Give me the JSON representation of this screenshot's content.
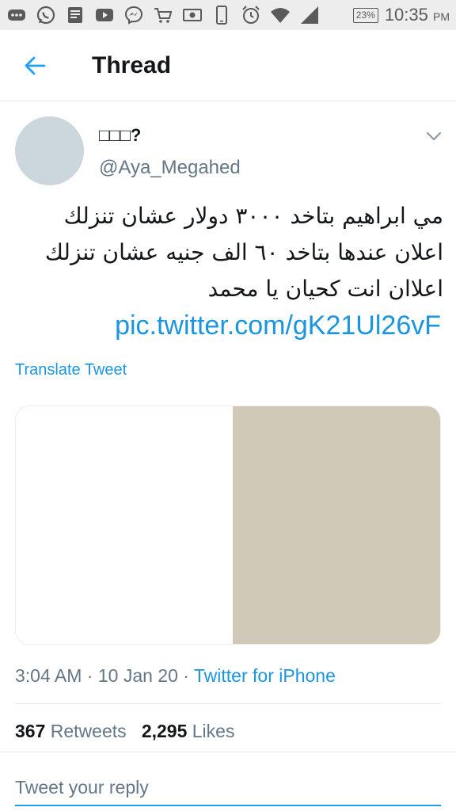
{
  "status_bar": {
    "icons": [
      "more-icon",
      "whatsapp-icon",
      "news-icon",
      "youtube-icon",
      "messenger-icon",
      "cart-icon",
      "cash-icon",
      "phone-icon",
      "alarm-icon",
      "wifi-icon",
      "signal-icon"
    ],
    "battery": "23%",
    "time": "10:35",
    "ampm": "PM"
  },
  "app_bar": {
    "title": "Thread"
  },
  "tweet": {
    "display_name": "□□□?",
    "handle": "@Aya_Megahed",
    "text": "مي ابراهيم بتاخد ٣٠٠٠ دولار عشان تنزلك اعلان عندها بتاخد ٦٠ الف جنيه عشان تنزلك اعلاان انت كحيان يا محمد",
    "link": "pic.twitter.com/gK21Ul26vF",
    "translate": "Translate Tweet",
    "time": "3:04 AM",
    "date": "10 Jan 20",
    "source": "Twitter for iPhone",
    "retweets": "367",
    "retweets_label": "Retweets",
    "likes": "2,295",
    "likes_label": "Likes"
  },
  "reply": {
    "placeholder": "Tweet your reply"
  },
  "colors": {
    "accent": "#1da1f2",
    "link": "#1b95e0",
    "muted": "#657786",
    "media": "#d0c9b8"
  }
}
